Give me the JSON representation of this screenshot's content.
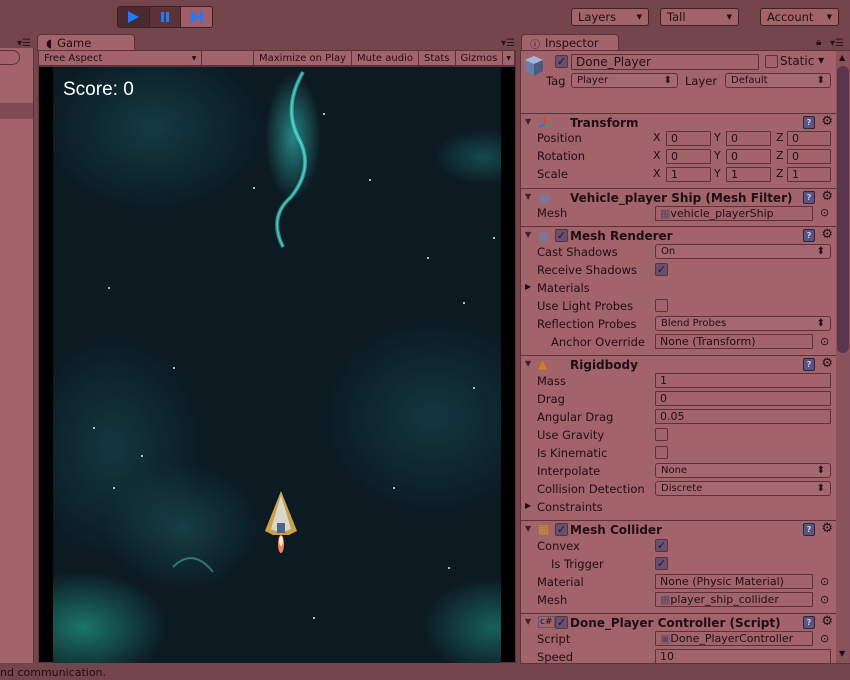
{
  "toolbar": {
    "play_icon": "play-icon",
    "pause_icon": "pause-icon",
    "step_icon": "step-icon",
    "layers": "Layers",
    "layout": "Tall",
    "account": "Account"
  },
  "game": {
    "tab_label": "Game",
    "aspect": "Free Aspect",
    "maximize": "Maximize on Play",
    "mute": "Mute audio",
    "stats": "Stats",
    "gizmos": "Gizmos",
    "score": "Score: 0"
  },
  "inspector": {
    "tab_label": "Inspector",
    "object_name": "Done_Player",
    "object_active": true,
    "static_label": "Static",
    "static": false,
    "tag_label": "Tag",
    "tag": "Player",
    "layer_label": "Layer",
    "layer": "Default",
    "transform": {
      "title": "Transform",
      "position_label": "Position",
      "rotation_label": "Rotation",
      "scale_label": "Scale",
      "position": {
        "x": "0",
        "y": "0",
        "z": "0"
      },
      "rotation": {
        "x": "0",
        "y": "0",
        "z": "0"
      },
      "scale": {
        "x": "1",
        "y": "1",
        "z": "1"
      }
    },
    "mesh_filter": {
      "title": "Vehicle_player Ship (Mesh Filter)",
      "mesh_label": "Mesh",
      "mesh": "vehicle_playerShip"
    },
    "mesh_renderer": {
      "title": "Mesh Renderer",
      "enabled": true,
      "cast_shadows_label": "Cast Shadows",
      "cast_shadows": "On",
      "receive_shadows_label": "Receive Shadows",
      "receive_shadows": true,
      "materials_label": "Materials",
      "use_light_probes_label": "Use Light Probes",
      "use_light_probes": false,
      "reflection_probes_label": "Reflection Probes",
      "reflection_probes": "Blend Probes",
      "anchor_override_label": "Anchor Override",
      "anchor_override": "None (Transform)"
    },
    "rigidbody": {
      "title": "Rigidbody",
      "mass_label": "Mass",
      "mass": "1",
      "drag_label": "Drag",
      "drag": "0",
      "angular_drag_label": "Angular Drag",
      "angular_drag": "0.05",
      "use_gravity_label": "Use Gravity",
      "use_gravity": false,
      "is_kinematic_label": "Is Kinematic",
      "is_kinematic": false,
      "interpolate_label": "Interpolate",
      "interpolate": "None",
      "collision_detection_label": "Collision Detection",
      "collision_detection": "Discrete",
      "constraints_label": "Constraints"
    },
    "mesh_collider": {
      "title": "Mesh Collider",
      "enabled": true,
      "convex_label": "Convex",
      "convex": true,
      "is_trigger_label": "Is Trigger",
      "is_trigger": true,
      "material_label": "Material",
      "material": "None (Physic Material)",
      "mesh_label": "Mesh",
      "mesh": "player_ship_collider"
    },
    "player_controller": {
      "title": "Done_Player Controller (Script)",
      "enabled": true,
      "script_label": "Script",
      "script": "Done_PlayerController",
      "speed_label": "Speed",
      "speed": "10"
    }
  },
  "status": {
    "message": "nd communication."
  }
}
